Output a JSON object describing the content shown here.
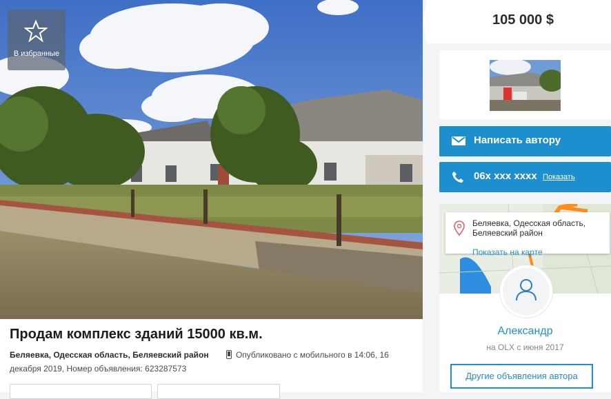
{
  "gallery": {
    "favorite_label": "В избранные"
  },
  "listing": {
    "title": "Продам комплекс зданий 15000 кв.м.",
    "location": "Беляевка, Одесская область, Беляевский район",
    "published": "Опубликовано с мобильного",
    "published_time": "в 14:06, 16 декабря 2019,",
    "ad_number": "Номер объявления: 623287573"
  },
  "sidebar": {
    "price": "105 000 $",
    "write_button": "Написать автору",
    "phone": "06x xxx xxxx",
    "phone_show": "Показать",
    "address": "Беляевка, Одесская область, Беляевский район",
    "show_on_map": "Показать на карте",
    "user_name": "Александр",
    "user_since": "на OLX с июня 2017",
    "other_ads_button": "Другие объявления автора"
  },
  "colors": {
    "accent": "#1d8fcf",
    "route": "#ff8c1a",
    "background": "#f2f4f5"
  },
  "icons": [
    "star-icon",
    "mobile-icon",
    "envelope-icon",
    "phone-icon",
    "map-pin-icon",
    "user-icon"
  ]
}
